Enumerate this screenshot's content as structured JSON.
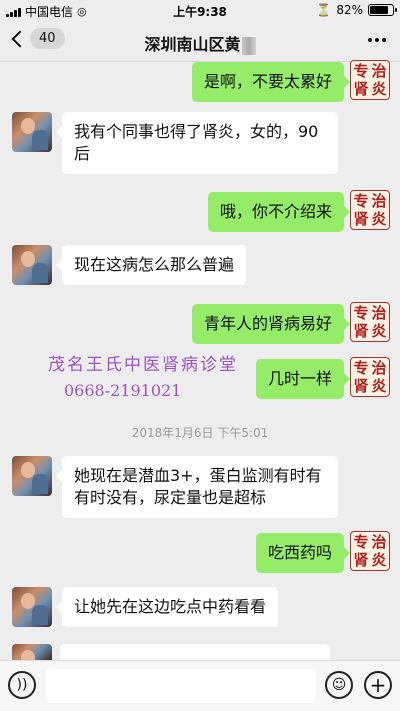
{
  "status_bar": {
    "carrier": "中国电信",
    "time": "上午9:38",
    "battery": "82%",
    "battery_level": 0.82
  },
  "header": {
    "back_count": "40",
    "title": "深圳南山区黄"
  },
  "messages": [
    {
      "from": "clinic",
      "text": "是啊，不要太累好"
    },
    {
      "from": "user",
      "text": "我有个同事也得了肾炎，女的，90后"
    },
    {
      "from": "clinic",
      "text": "哦，你不介绍来"
    },
    {
      "from": "user",
      "text": "现在这病怎么那么普遍"
    },
    {
      "from": "clinic",
      "text": "青年人的肾病易好"
    },
    {
      "from": "clinic",
      "text": "几时一样"
    },
    {
      "from": "user",
      "text": "她现在是潜血3+，蛋白监测有时有有时没有，尿定量也是超标"
    },
    {
      "from": "clinic",
      "text": "吃西药吗"
    },
    {
      "from": "user",
      "text": "让她先在这边吃点中药看看"
    }
  ],
  "clinic_avatar_chars": [
    "专",
    "治",
    "肾",
    "炎"
  ],
  "timestamp": "2018年1月6日 下午5:01",
  "watermark": {
    "name": "茂名王氏中医肾病诊堂",
    "phone": "0668-2191021"
  },
  "input": {
    "value": ""
  }
}
